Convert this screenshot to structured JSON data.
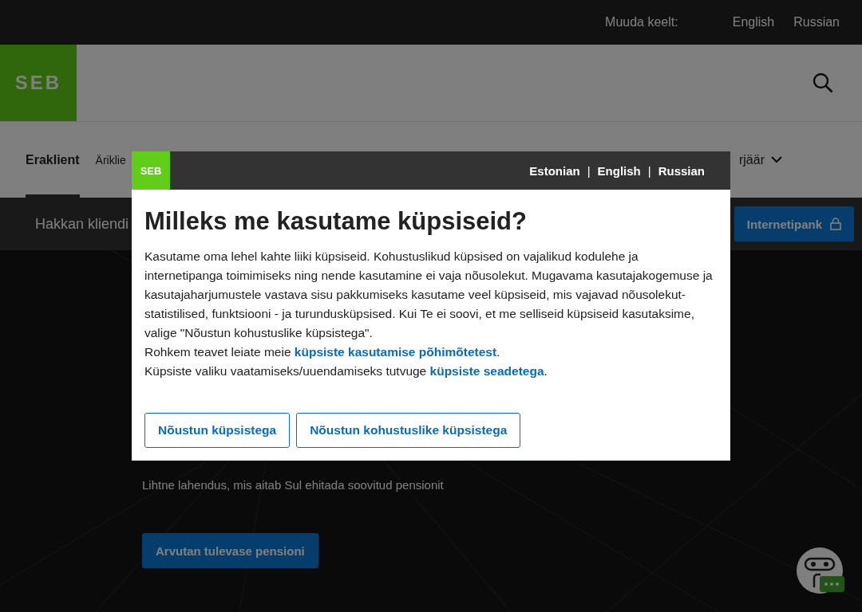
{
  "top_bar": {
    "label": "Muuda keelt:",
    "languages": [
      {
        "label": "English"
      },
      {
        "label": "Russian"
      }
    ]
  },
  "header": {
    "logo": "SEB"
  },
  "nav": {
    "items": [
      {
        "label": "Eraklient",
        "selected": true,
        "kind": "link"
      },
      {
        "label": "Äriklie",
        "selected": false,
        "kind": "link"
      },
      {
        "label": "rjäär",
        "selected": false,
        "kind": "dropdown"
      }
    ]
  },
  "sub_bar": {
    "label": "Hakkan kliendi",
    "button": "Internetipank"
  },
  "hero": {
    "subtitle": "Lihtne lahendus, mis aitab Sul ehitada soovitud pensionit",
    "button": "Arvutan tulevase pensioni"
  },
  "cookie_dialog": {
    "logo": "SEB",
    "languages": [
      {
        "label": "Estonian"
      },
      {
        "label": "English"
      },
      {
        "label": "Russian"
      }
    ],
    "separator": "|",
    "title": "Milleks me kasutame küpsiseid?",
    "paragraphs": [
      {
        "text": "Kasutame oma lehel kahte liiki küpsiseid. Kohustuslikud küpsised on vajalikud kodulehe ja internetipanga toimimiseks ning nende kasutamine ei vaja nõusolekut. Mugavama kasutajakogemuse ja kasutajaharjumustele vastava sisu pakkumiseks kasutame veel küpsiseid, mis vajavad nõusolekut- statistilised, funktsiooni - ja turundusküpsised. Kui Te ei soovi, et me selliseid küpsiseid kasutaksime, valige \"Nõustun kohustuslike küpsistega\"."
      },
      {
        "text": "Rohkem teavet leiate meie ",
        "link": "küpsiste kasutamise põhimõtetest",
        "after": "."
      },
      {
        "text": "Küpsiste valiku vaatamiseks/uuendamiseks tutvuge ",
        "link": "küpsiste seadetega",
        "after": "."
      }
    ],
    "buttons": [
      {
        "label": "Nõustun küpsistega"
      },
      {
        "label": "Nõustun kohustuslike küpsistega"
      }
    ]
  }
}
